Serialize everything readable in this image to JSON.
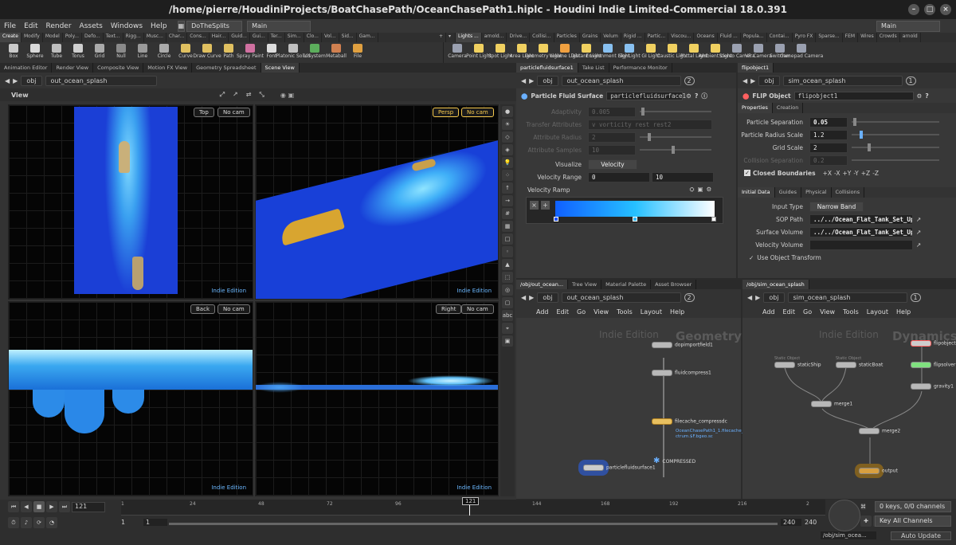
{
  "title": "/home/pierre/HoudiniProjects/BoatChasePath/OceanChasePath1.hiplc - Houdini Indie Limited-Commercial 18.0.391",
  "menu": [
    "File",
    "Edit",
    "Render",
    "Assets",
    "Windows",
    "Help"
  ],
  "desktop": "DoTheSplits",
  "desktop2": "Main",
  "desktop_right": "Main",
  "shelf_left_tabs": [
    "Create",
    "Modify",
    "Model",
    "Poly...",
    "Defo...",
    "Text...",
    "Rigg...",
    "Musc...",
    "Char...",
    "Cons...",
    "Hair...",
    "Guid...",
    "Gui...",
    "Ter...",
    "Sim...",
    "Clo...",
    "Vol...",
    "Sid...",
    "Gam..."
  ],
  "shelf_right_tabs": [
    "Lights ...",
    "arnold...",
    "Drive...",
    "Collisi...",
    "Particles",
    "Grains",
    "Velum",
    "Rigid ...",
    "Partic...",
    "Viscou...",
    "Oceans",
    "Fluid ...",
    "Popula...",
    "Contai...",
    "Pyro FX",
    "Sparse...",
    "FEM",
    "Wires",
    "Crowds",
    "arnold"
  ],
  "tools_left": [
    {
      "label": "Box",
      "color": "#c9c9c9"
    },
    {
      "label": "Sphere",
      "color": "#d9d9d9"
    },
    {
      "label": "Tube",
      "color": "#bdbdbd"
    },
    {
      "label": "Torus",
      "color": "#cfcfcf"
    },
    {
      "label": "Grid",
      "color": "#aaaaaa"
    },
    {
      "label": "Null",
      "color": "#8a8a8a"
    },
    {
      "label": "Line",
      "color": "#9a9a9a"
    },
    {
      "label": "Circle",
      "color": "#aaaaaa"
    },
    {
      "label": "Curve",
      "color": "#e0c060"
    },
    {
      "label": "Draw Curve",
      "color": "#e0c060"
    },
    {
      "label": "Path",
      "color": "#e0c060"
    },
    {
      "label": "Spray Paint",
      "color": "#d070a0"
    },
    {
      "label": "Font",
      "color": "#dddddd"
    },
    {
      "label": "Platonic Solids",
      "color": "#c0c0c0"
    },
    {
      "label": "L-System",
      "color": "#5cae5c"
    },
    {
      "label": "Metaball",
      "color": "#d08050"
    },
    {
      "label": "File",
      "color": "#e0a040"
    }
  ],
  "tools_right": [
    {
      "label": "Camera",
      "color": "#9aa0b0"
    },
    {
      "label": "Point Light",
      "color": "#f0d060"
    },
    {
      "label": "Spot Light",
      "color": "#f0d060"
    },
    {
      "label": "Area Light",
      "color": "#f0d060"
    },
    {
      "label": "Geometry Light",
      "color": "#f0d060"
    },
    {
      "label": "Volume Light",
      "color": "#f0a040"
    },
    {
      "label": "Distant Light",
      "color": "#f0d060"
    },
    {
      "label": "Environment Light",
      "color": "#88c0f0"
    },
    {
      "label": "Sky Light",
      "color": "#88c0f0"
    },
    {
      "label": "GI Light",
      "color": "#f0d060"
    },
    {
      "label": "Caustic Light",
      "color": "#f0d060"
    },
    {
      "label": "Portal Light",
      "color": "#f0d060"
    },
    {
      "label": "Ambient Light",
      "color": "#f0d060"
    },
    {
      "label": "Stereo Camera",
      "color": "#9aa0b0"
    },
    {
      "label": "VR Camera",
      "color": "#9aa0b0"
    },
    {
      "label": "Switcher",
      "color": "#9aa0b0"
    },
    {
      "label": "Gamepad Camera",
      "color": "#9aa0b0"
    }
  ],
  "viewer": {
    "tabs": [
      "Animation Editor",
      "Render View",
      "Composite View",
      "Motion FX View",
      "Geometry Spreadsheet",
      "Scene View"
    ],
    "path_obj": "obj",
    "path": "out_ocean_splash",
    "label": "View",
    "indie": "Indie Edition",
    "vp_top": {
      "view": "Top",
      "cam": "No cam"
    },
    "vp_persp": {
      "view": "Persp",
      "cam": "No cam"
    },
    "vp_back": {
      "view": "Back",
      "cam": "No cam"
    },
    "vp_right": {
      "view": "Right",
      "cam": "No cam"
    },
    "side_abc": "abc"
  },
  "params1": {
    "tabs": [
      "particlefluidsurface1",
      "Take List",
      "Performance Monitor"
    ],
    "path_obj": "obj",
    "path": "out_ocean_splash",
    "badge": "2",
    "type": "Particle Fluid Surface",
    "name": "particlefluidsurface1",
    "rows": [
      {
        "label": "Adaptivity",
        "value": "0.005"
      },
      {
        "label": "Transfer Attributes",
        "value": "v vorticity rest rest2"
      },
      {
        "label": "Attribute Radius",
        "value": "2"
      },
      {
        "label": "Attribute Samples",
        "value": "10"
      }
    ],
    "visualize_label": "Visualize",
    "visualize": "Velocity",
    "velrange_label": "Velocity Range",
    "vmin": "0",
    "vmax": "10",
    "ramp_label": "Velocity Ramp"
  },
  "params2": {
    "tab": "flipobject1",
    "path_obj": "obj",
    "path": "sim_ocean_splash",
    "badge": "1",
    "type": "FLIP Object",
    "name": "flipobject1",
    "tabs": [
      "Properties",
      "Creation"
    ],
    "rows": [
      {
        "label": "Particle Separation",
        "value": "0.05"
      },
      {
        "label": "Particle Radius Scale",
        "value": "1.2"
      },
      {
        "label": "Grid Scale",
        "value": "2"
      },
      {
        "label": "Collision Separation",
        "value": "0.2"
      }
    ],
    "closed_label": "Closed Boundaries",
    "axes": [
      "+X",
      "-X",
      "+Y",
      "-Y",
      "+Z",
      "-Z"
    ],
    "tabs2": [
      "Initial Data",
      "Guides",
      "Physical",
      "Collisions"
    ],
    "input_type_label": "Input Type",
    "input_type": "Narrow Band",
    "sop_label": "SOP Path",
    "sop": "../../Ocean_Flat_Tank_Set_Up/",
    "surf_label": "Surface Volume",
    "surf": "../../Ocean_Flat_Tank_Set_Up/",
    "vel_label": "Velocity Volume",
    "use_obj": "Use Object Transform"
  },
  "net1": {
    "tabs": [
      "/obj/out_ocean...",
      "Tree View",
      "Material Palette",
      "Asset Browser"
    ],
    "path_obj": "obj",
    "path": "out_ocean_splash",
    "badge": "2",
    "menu": [
      "Add",
      "Edit",
      "Go",
      "View",
      "Tools",
      "Layout",
      "Help"
    ],
    "watermark1": "Indie Edition",
    "watermark2": "Geometry",
    "nodes": [
      "dopimportfield1",
      "fluidcompress1",
      "filecache_compressdc",
      "particlefluidsurface1",
      "COMPRESSED"
    ],
    "filepath": "OceanChasePath1_1.filecache_sp\nctrum.$F.bgeo.sc"
  },
  "net2": {
    "tab": "/obj/sim_ocean_splash",
    "path_obj": "obj",
    "path": "sim_ocean_splash",
    "badge": "1",
    "menu": [
      "Add",
      "Edit",
      "Go",
      "View",
      "Tools",
      "Layout",
      "Help"
    ],
    "watermark1": "Indie Edition",
    "watermark2": "Dynamics",
    "nodes": [
      "flipobject1",
      "staticShip",
      "staticBoat",
      "flipsolver1",
      "gravity1",
      "merge1",
      "merge2",
      "output"
    ],
    "static_label": "Static Object"
  },
  "timeline": {
    "frame": "121",
    "ticks": [
      "1",
      "24",
      "48",
      "72",
      "96",
      "121",
      "144",
      "168",
      "192",
      "216",
      "2"
    ],
    "start": "1",
    "start2": "1",
    "end": "240",
    "end2": "240",
    "keys": "0 keys, 0/0 channels",
    "keyall": "Key All Channels",
    "status": "/obj/sim_ocea...",
    "autoupdate": "Auto Update"
  },
  "colors": {
    "ramp_start": "#1060ff",
    "ramp_end": "#ffffff",
    "water": "#1a3fd0",
    "boat": "#d8a530"
  }
}
